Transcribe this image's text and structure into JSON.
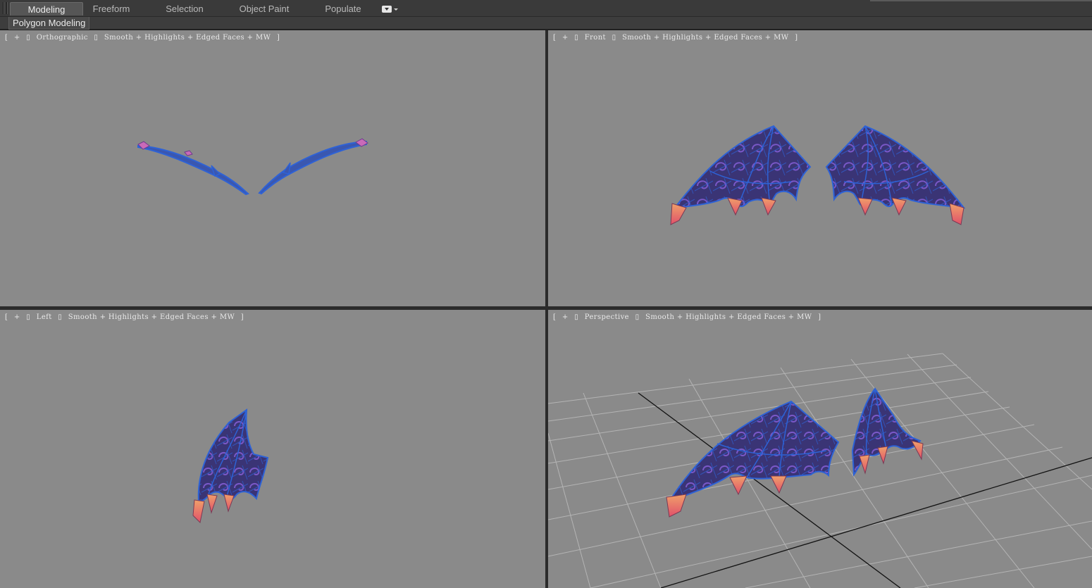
{
  "ribbon": {
    "tabs": [
      {
        "label": "Modeling",
        "active": true
      },
      {
        "label": "Freeform",
        "active": false
      },
      {
        "label": "Selection",
        "active": false
      },
      {
        "label": "Object Paint",
        "active": false
      },
      {
        "label": "Populate",
        "active": false
      }
    ],
    "more_icon": "dropdown-arrow-icon",
    "panel_label": "Polygon Modeling"
  },
  "viewports": {
    "top_left": {
      "label_open": "[",
      "plus": "+",
      "view": "Orthographic",
      "shading": "Smooth + Highlights + Edged Faces + MW",
      "label_close": "]"
    },
    "top_right": {
      "label_open": "[",
      "plus": "+",
      "view": "Front",
      "shading": "Smooth + Highlights + Edged Faces + MW",
      "label_close": "]"
    },
    "bottom_left": {
      "label_open": "[",
      "plus": "+",
      "view": "Left",
      "shading": "Smooth + Highlights + Edged Faces + MW",
      "label_close": "]"
    },
    "bottom_right": {
      "label_open": "[",
      "plus": "+",
      "view": "Perspective",
      "shading": "Smooth + Highlights + Edged Faces + MW",
      "label_close": "]"
    }
  },
  "colors": {
    "viewport_bg": "#8a8a8a",
    "wing_fill": "#3b3577",
    "wing_edge": "#2f5fd0",
    "claw_fill": "#f28a5a",
    "grid_line": "#b4b4b4",
    "axis_line": "#111111"
  }
}
